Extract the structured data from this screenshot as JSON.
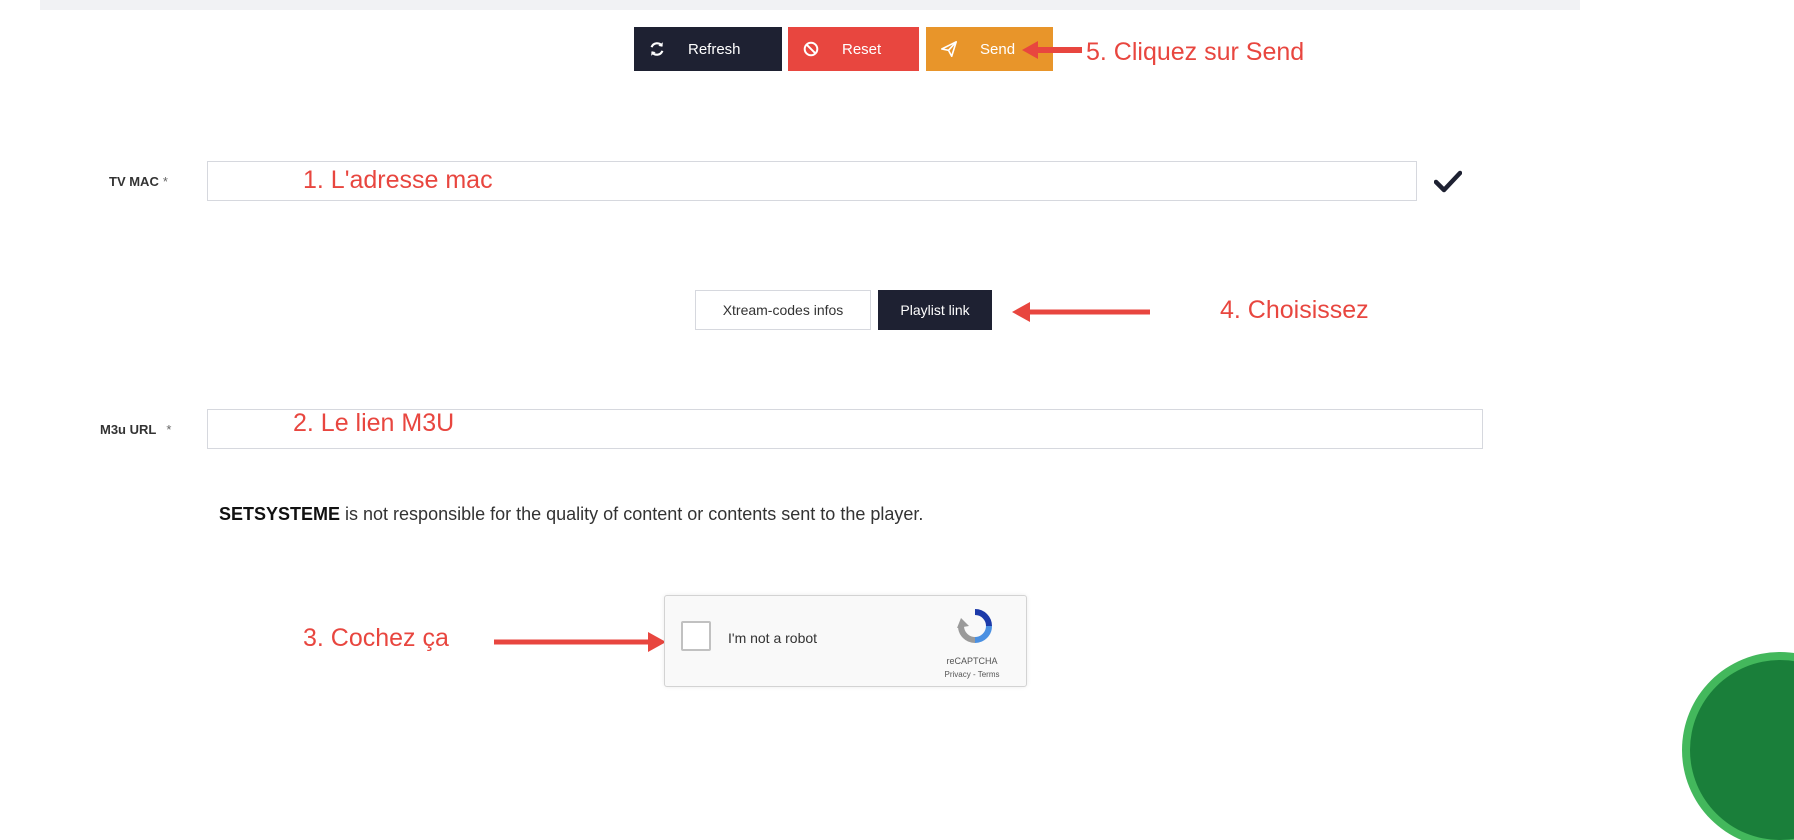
{
  "toolbar": {
    "refresh_label": "Refresh",
    "reset_label": "Reset",
    "send_label": "Send",
    "colors": {
      "refresh": "#1e2132",
      "reset": "#e8463f",
      "send": "#e8952a"
    }
  },
  "form": {
    "tvmac": {
      "label": "TV MAC",
      "required_mark": "*",
      "value": ""
    },
    "mode_tabs": {
      "xtream_label": "Xtream-codes infos",
      "playlist_label": "Playlist link",
      "selected": "Playlist link"
    },
    "m3u": {
      "label": "M3u URL",
      "required_mark": "*",
      "value": ""
    }
  },
  "disclaimer": {
    "brand": "SETSYSTEME",
    "text": " is not responsible for the quality of content or contents sent to the player."
  },
  "captcha": {
    "label": "I'm not a robot",
    "brand": "reCAPTCHA",
    "links": "Privacy - Terms"
  },
  "annotations": {
    "step1": "1. L'adresse mac",
    "step2": "2. Le lien M3U",
    "step3": "3. Cochez ça",
    "step4": "4. Choisissez",
    "step5": "5. Cliquez sur Send",
    "color": "#e8463f"
  }
}
